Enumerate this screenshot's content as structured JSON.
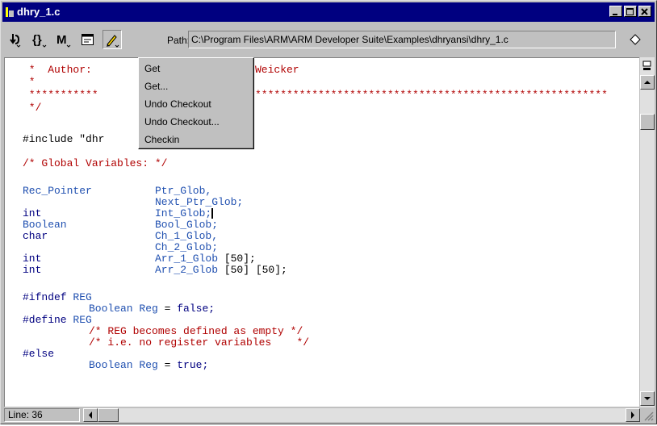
{
  "window": {
    "title": "dhry_1.c",
    "controls": [
      "minimize",
      "maximize",
      "close"
    ]
  },
  "toolbar": {
    "tools": [
      {
        "name": "step-into-icon"
      },
      {
        "name": "braces-icon"
      },
      {
        "name": "bookmark-icon"
      },
      {
        "name": "properties-icon"
      },
      {
        "name": "pencil-icon"
      }
    ],
    "path_label": "Path:",
    "path_value": "C:\\Program Files\\ARM\\ARM Developer Suite\\Examples\\dhryansi\\dhry_1.c"
  },
  "context_menu": {
    "items": [
      "Get",
      "Get...",
      "Undo Checkout",
      "Undo Checkout...",
      "Checkin"
    ]
  },
  "code": {
    "line1_a": " *  Author:",
    "line1_b": "Weicker",
    "line2": " *",
    "line3_a": " ***********",
    "line3_b": "********************************************************",
    "line4": " */",
    "line5": "#include \"dhr",
    "line6": "/* Global Variables: */",
    "line7_a": "Rec_Pointer",
    "line7_b": "Ptr_Glob,",
    "line8": "Next_Ptr_Glob;",
    "line9_a": "int",
    "line9_b": "Int_Glob;",
    "line10_a": "Boolean",
    "line10_b": "Bool_Glob;",
    "line11_a": "char",
    "line11_b": "Ch_1_Glob,",
    "line12": "Ch_2_Glob;",
    "line13_a": "int",
    "line13_b": "Arr_1_Glob",
    "line13_c": " [50];",
    "line14_a": "int",
    "line14_b": "Arr_2_Glob",
    "line14_c": " [50] [50];",
    "line15_a": "#ifndef",
    "line15_b": " REG",
    "line16_a": "Boolean Reg",
    "line16_b": " = ",
    "line16_c": "false;",
    "line17_a": "#define",
    "line17_b": " REG",
    "line18": "/* REG becomes defined as empty */",
    "line19": "/* i.e. no register variables    */",
    "line20": "#else",
    "line21_a": "Boolean Reg",
    "line21_b": " = ",
    "line21_c": "true;"
  },
  "status": {
    "line_label": "Line: 36"
  },
  "colors": {
    "titlebar": "#000080",
    "keyword": "#000080",
    "identifier": "#2050b0",
    "comment": "#b00000"
  }
}
